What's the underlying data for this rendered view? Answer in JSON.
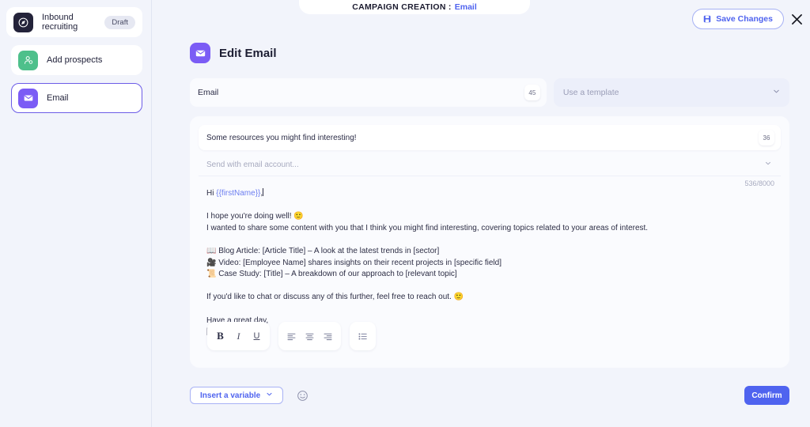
{
  "header": {
    "banner_label": "CAMPAIGN CREATION :",
    "banner_value": "Email",
    "save_label": "Save Changes",
    "close_label": "×"
  },
  "sidebar": {
    "items": [
      {
        "label": "Inbound recruiting",
        "badge": "Draft",
        "icon": "compass-icon",
        "selected": false
      },
      {
        "label": "Add prospects",
        "badge": "",
        "icon": "user-add-icon",
        "selected": false
      },
      {
        "label": "Email",
        "badge": "",
        "icon": "envelope-icon",
        "selected": true
      }
    ]
  },
  "main": {
    "page_title": "Edit Email",
    "page_icon": "envelope-icon",
    "email_name_value": "Email",
    "email_name_count": "45",
    "template_placeholder": "Use a template",
    "subject_value": "Some resources you might find interesting!",
    "subject_count": "36",
    "account_placeholder": "Send with email account...",
    "char_count": "536/8000",
    "body": {
      "greeting_prefix": "Hi ",
      "greeting_variable": "{{firstName}}",
      "greeting_suffix": ",",
      "line_hope": "I hope you're doing well! 🙂",
      "line_intro": "I wanted to share some content with you that I think you might find interesting, covering topics related to your areas of interest.",
      "bullets": [
        "📖 Blog Article: [Article Title] – A look at the latest trends in [sector]",
        "🎥 Video: [Employee Name] shares insights on their recent projects in [specific field]",
        "📜 Case Study: [Title] – A breakdown of our approach to [relevant topic]"
      ],
      "line_cta": "If you'd like to chat or discuss any of this further, feel free to reach out. 🙂",
      "line_signoff": "Have a great day,",
      "line_signature": "[Email Signature]"
    },
    "toolbar": {
      "bold": "B",
      "italic": "I",
      "underline": "U",
      "align_left": "align-left-icon",
      "align_center": "align-center-icon",
      "align_right": "align-right-icon",
      "bullet_list": "bullet-list-icon"
    },
    "footer": {
      "insert_variable_label": "Insert a variable",
      "emoji_label": "emoji-icon",
      "confirm_label": "Confirm"
    }
  },
  "colors": {
    "accent": "#4f63ef",
    "purple": "#7b5cf5",
    "green": "#4ec08b",
    "dark": "#24233a",
    "background": "#f2f4fb"
  }
}
